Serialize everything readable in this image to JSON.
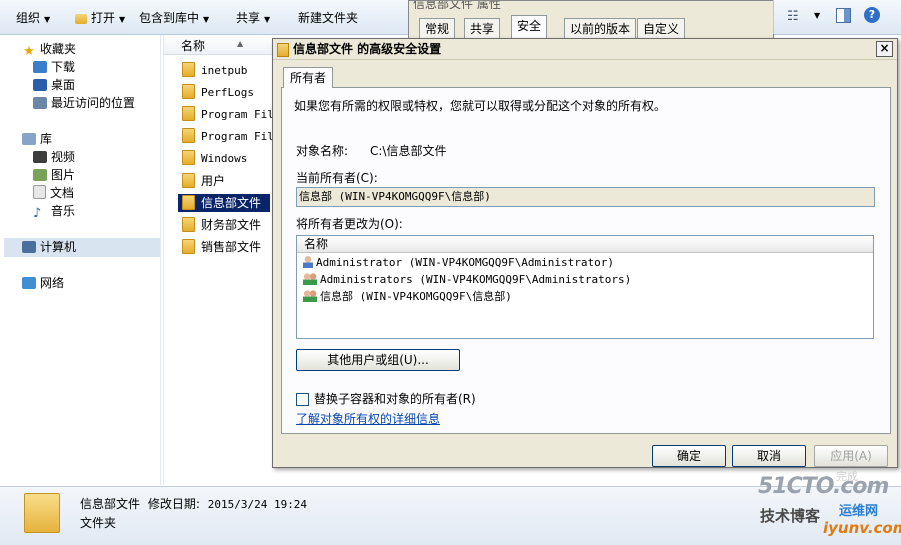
{
  "toolbar": {
    "organize": "组织",
    "open": "打开",
    "include_library": "包含到库中",
    "share": "共享",
    "new_folder": "新建文件夹"
  },
  "nav": {
    "favorites": "收藏夹",
    "favorites_items": [
      "下载",
      "桌面",
      "最近访问的位置"
    ],
    "libraries": "库",
    "library_items": [
      "视频",
      "图片",
      "文档",
      "音乐"
    ],
    "computer": "计算机",
    "network": "网络"
  },
  "filelist": {
    "column_name": "名称",
    "files": [
      "inetpub",
      "PerfLogs",
      "Program File",
      "Program File",
      "Windows",
      "用户",
      "信息部文件",
      "财务部文件",
      "销售部文件"
    ]
  },
  "properties_window": {
    "title": "信息部文件 属性",
    "tabs": [
      "常规",
      "共享",
      "安全",
      "以前的版本",
      "自定义"
    ],
    "active_tab": "安全"
  },
  "dialog": {
    "title": "信息部文件 的高级安全设置",
    "close": "×",
    "tab": "所有者",
    "intro": "如果您有所需的权限或特权，您就可以取得或分配这个对象的所有权。",
    "object_name_label": "对象名称:",
    "object_name_value": "C:\\信息部文件",
    "current_owner_label": "当前所有者(C):",
    "current_owner_value": "信息部 (WIN-VP4KOMGQQ9F\\信息部)",
    "change_owner_label": "将所有者更改为(O):",
    "list_header": "名称",
    "owners": [
      "Administrator (WIN-VP4KOMGQQ9F\\Administrator)",
      "Administrators (WIN-VP4KOMGQQ9F\\Administrators)",
      "信息部 (WIN-VP4KOMGQQ9F\\信息部)"
    ],
    "other_users_button": "其他用户或组(U)...",
    "replace_checkbox_label": "替换子容器和对象的所有者(R)",
    "replace_checked": false,
    "learn_more_link": "了解对象所有权的详细信息",
    "ok": "确定",
    "cancel": "取消",
    "apply": "应用(A)"
  },
  "details": {
    "name": "信息部文件",
    "modified_label": "修改日期:",
    "modified_value": "2015/3/24 19:24",
    "type": "文件夹"
  },
  "watermark": {
    "site": "51CTO.com",
    "line2": "技术博客",
    "line3": "运维网",
    "url": "iyunv.com",
    "extra": "完成"
  },
  "colors": {
    "selection": "#0a246a",
    "dialog_bg": "#ece9d8",
    "link": "#0645ad"
  }
}
